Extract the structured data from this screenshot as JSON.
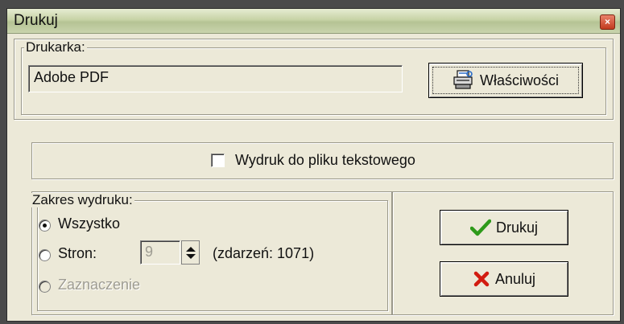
{
  "window": {
    "title": "Drukuj",
    "close_glyph": "×"
  },
  "printer": {
    "group_label": "Drukarka:",
    "name_value": "Adobe PDF",
    "properties_label": "Właściwości"
  },
  "text_file": {
    "label": "Wydruk do pliku tekstowego",
    "checked": false
  },
  "range": {
    "group_label": "Zakres wydruku:",
    "all_label": "Wszystko",
    "pages_label": "Stron:",
    "pages_value": "9",
    "events_label": "(zdarzeń: 1071)",
    "selection_label": "Zaznaczenie"
  },
  "actions": {
    "print_label": "Drukuj",
    "cancel_label": "Anuluj"
  },
  "colors": {
    "check_green": "#2e9a1a",
    "cancel_red": "#d21c10"
  },
  "icons": [
    "printer-icon",
    "checkmark-icon",
    "cross-icon",
    "close-icon"
  ]
}
